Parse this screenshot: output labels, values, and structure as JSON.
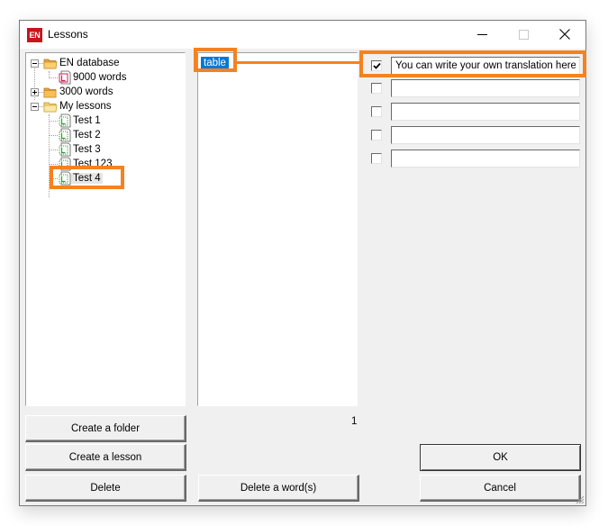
{
  "window": {
    "title": "Lessons",
    "app_icon_text": "EN",
    "controls": [
      "minimize",
      "maximize",
      "close"
    ]
  },
  "tree": {
    "items": [
      {
        "label": "EN database",
        "type": "folder",
        "expanded": true,
        "level": 0
      },
      {
        "label": "9000 words",
        "type": "lesson-db",
        "level": 1
      },
      {
        "label": "3000 words",
        "type": "folder",
        "expanded": false,
        "level": 0
      },
      {
        "label": "My lessons",
        "type": "folder",
        "expanded": true,
        "level": 0
      },
      {
        "label": "Test 1",
        "type": "lesson",
        "level": 1
      },
      {
        "label": "Test 2",
        "type": "lesson",
        "level": 1
      },
      {
        "label": "Test 3",
        "type": "lesson",
        "level": 1
      },
      {
        "label": "Test 123",
        "type": "lesson",
        "level": 1
      },
      {
        "label": "Test 4",
        "type": "lesson",
        "level": 1,
        "selected": true
      }
    ]
  },
  "words": {
    "items": [
      {
        "label": "table",
        "selected": true
      }
    ],
    "count": "1"
  },
  "translations": [
    {
      "checked": true,
      "value": "You can write your own translation here"
    },
    {
      "checked": false,
      "value": ""
    },
    {
      "checked": false,
      "value": ""
    },
    {
      "checked": false,
      "value": ""
    },
    {
      "checked": false,
      "value": ""
    }
  ],
  "buttons": {
    "create_folder": "Create a folder",
    "create_lesson": "Create a lesson",
    "delete": "Delete",
    "delete_words": "Delete a word(s)",
    "ok": "OK",
    "cancel": "Cancel"
  },
  "colors": {
    "highlight": "#f58220",
    "selection": "#0078d7",
    "app_icon": "#c8141a"
  }
}
